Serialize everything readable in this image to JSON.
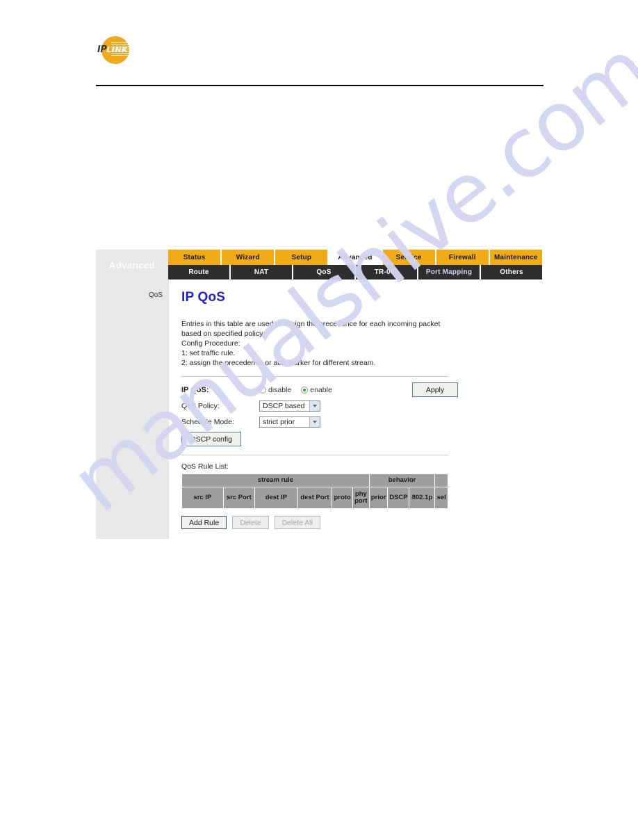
{
  "masthead": {
    "logo": {
      "text_primary": "IP",
      "text_secondary": "LINK",
      "circle_color": "#f0a81e"
    }
  },
  "watermark": {
    "text": "manualshive.com",
    "color": "#d4d4f2"
  },
  "router_ui": {
    "sidebar_header_label": "Advanced",
    "primary_tabs": [
      {
        "label": "Status",
        "active": false
      },
      {
        "label": "Wizard",
        "active": false
      },
      {
        "label": "Setup",
        "active": false
      },
      {
        "label": "Advanced",
        "active": true
      },
      {
        "label": "Service",
        "active": false
      },
      {
        "label": "Firewall",
        "active": false
      },
      {
        "label": "Maintenance",
        "active": false
      }
    ],
    "sub_tabs": [
      {
        "label": "Route",
        "hovered": false
      },
      {
        "label": "NAT",
        "hovered": false
      },
      {
        "label": "QoS",
        "hovered": false
      },
      {
        "label": "TR-069",
        "hovered": false
      },
      {
        "label": "Port Mapping",
        "hovered": true
      },
      {
        "label": "Others",
        "hovered": false
      }
    ],
    "sidebar_items": [
      {
        "label": "QoS"
      }
    ],
    "page_title": "IP QoS",
    "description": [
      "Entries in this table are used to assign the precedence for each incoming packet",
      "based on specified policy.",
      "Config Procedure:",
      "1: set traffic rule.",
      "2: assign the precedence or add marker for different stream."
    ],
    "form": {
      "ip_qos_label": "IP QoS:",
      "radio_disable_label": "disable",
      "radio_enable_label": "enable",
      "radio_selected": "enable",
      "apply_label": "Apply",
      "qos_policy_label": "QoS Policy:",
      "qos_policy_value": "DSCP based",
      "schedule_mode_label": "Schedule Mode:",
      "schedule_mode_value": "strict prior",
      "dscp_config_label": "DSCP config"
    },
    "rule_list": {
      "caption": "QoS Rule List:",
      "group_headers": [
        {
          "label": "stream rule",
          "span": 6
        },
        {
          "label": "behavior",
          "span": 3
        },
        {
          "label": "",
          "span": 1
        }
      ],
      "column_headers": [
        "src IP",
        "src Port",
        "dest IP",
        "dest Port",
        "proto",
        "phy port",
        "prior",
        "DSCP",
        "802.1p",
        "sel"
      ],
      "rows": []
    },
    "buttons": [
      {
        "label": "Add Rule",
        "enabled": true
      },
      {
        "label": "Delete",
        "enabled": false
      },
      {
        "label": "Delete All",
        "enabled": false
      }
    ]
  }
}
